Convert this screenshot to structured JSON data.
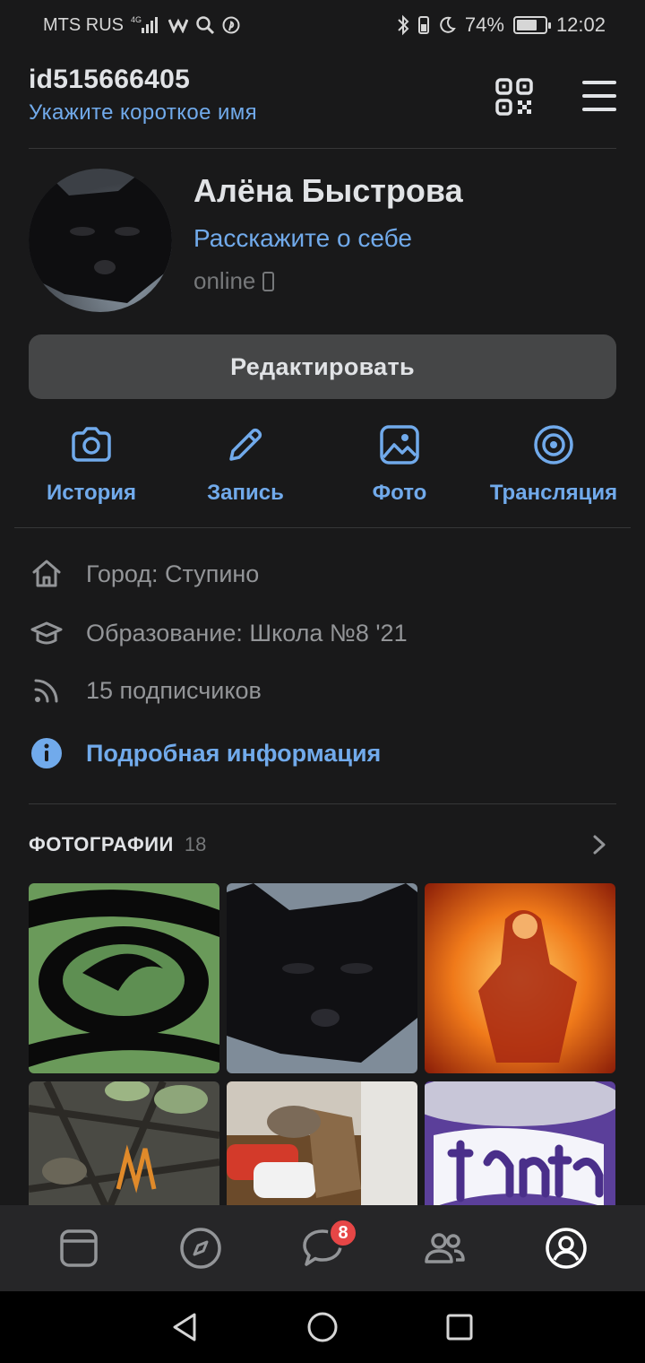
{
  "status_bar": {
    "carrier": "MTS RUS",
    "network": "4G",
    "battery_percent": "74%",
    "battery_level": 0.74,
    "time": "12:02"
  },
  "header": {
    "user_id": "id515666405",
    "short_name_prompt": "Укажите короткое имя"
  },
  "profile": {
    "name": "Алёна Быстрова",
    "about_prompt": "Расскажите о себе",
    "status": "online"
  },
  "edit_button": "Редактировать",
  "actions": [
    {
      "label": "История",
      "icon": "camera-icon"
    },
    {
      "label": "Запись",
      "icon": "pencil-icon"
    },
    {
      "label": "Фото",
      "icon": "image-icon"
    },
    {
      "label": "Трансляция",
      "icon": "broadcast-icon"
    }
  ],
  "info": {
    "city": "Город: Ступино",
    "education": "Образование: Школа №8 '21",
    "followers": "15 подписчиков",
    "details_link": "Подробная информация"
  },
  "photos": {
    "title": "ФОТОГРАФИИ",
    "count": "18"
  },
  "tabbar": {
    "messages_badge": "8",
    "active_tab": "profile"
  },
  "colors": {
    "background": "#19191a",
    "accent": "#71aaeb",
    "badge": "#e64646",
    "button": "#454647"
  }
}
